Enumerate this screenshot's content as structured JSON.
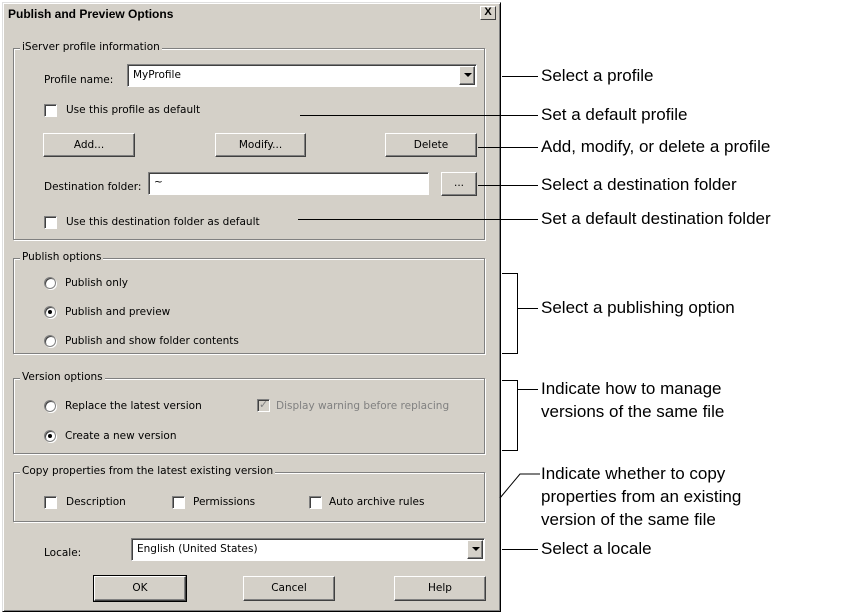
{
  "dialog": {
    "title": "Publish and Preview Options",
    "close_label": "X"
  },
  "profile_group": {
    "legend": "iServer profile information",
    "profile_label": "Profile name:",
    "profile_value": "MyProfile",
    "default_profile_label": "Use this profile as default",
    "add_label": "Add...",
    "modify_label": "Modify...",
    "delete_label": "Delete",
    "dest_label": "Destination folder:",
    "dest_value": "~",
    "browse_label": "...",
    "default_dest_label": "Use this destination folder as default"
  },
  "publish_group": {
    "legend": "Publish options",
    "options": [
      "Publish only",
      "Publish and preview",
      "Publish and show folder contents"
    ],
    "selected": "Publish and preview"
  },
  "version_group": {
    "legend": "Version options",
    "replace_label": "Replace the latest version",
    "warning_label": "Display warning before replacing",
    "warning_checked": true,
    "create_label": "Create a new version",
    "selected": "Create a new version"
  },
  "copy_group": {
    "legend": "Copy properties from the latest existing version",
    "description_label": "Description",
    "permissions_label": "Permissions",
    "archive_label": "Auto archive rules"
  },
  "locale": {
    "label": "Locale:",
    "value": "English (United States)"
  },
  "buttons": {
    "ok": "OK",
    "cancel": "Cancel",
    "help": "Help"
  },
  "callouts": {
    "select_profile": "Select a profile",
    "set_default_profile": "Set a default profile",
    "add_modify_delete": "Add, modify, or delete a profile",
    "select_destination": "Select a destination folder",
    "set_default_destination": "Set a default destination folder",
    "select_publishing": "Select a publishing option",
    "manage_versions_1": "Indicate how to manage",
    "manage_versions_2": "versions of the same file",
    "copy_properties_1": "Indicate whether to copy",
    "copy_properties_2": "properties from an existing",
    "copy_properties_3": "version of the same file",
    "select_locale": "Select a locale"
  }
}
